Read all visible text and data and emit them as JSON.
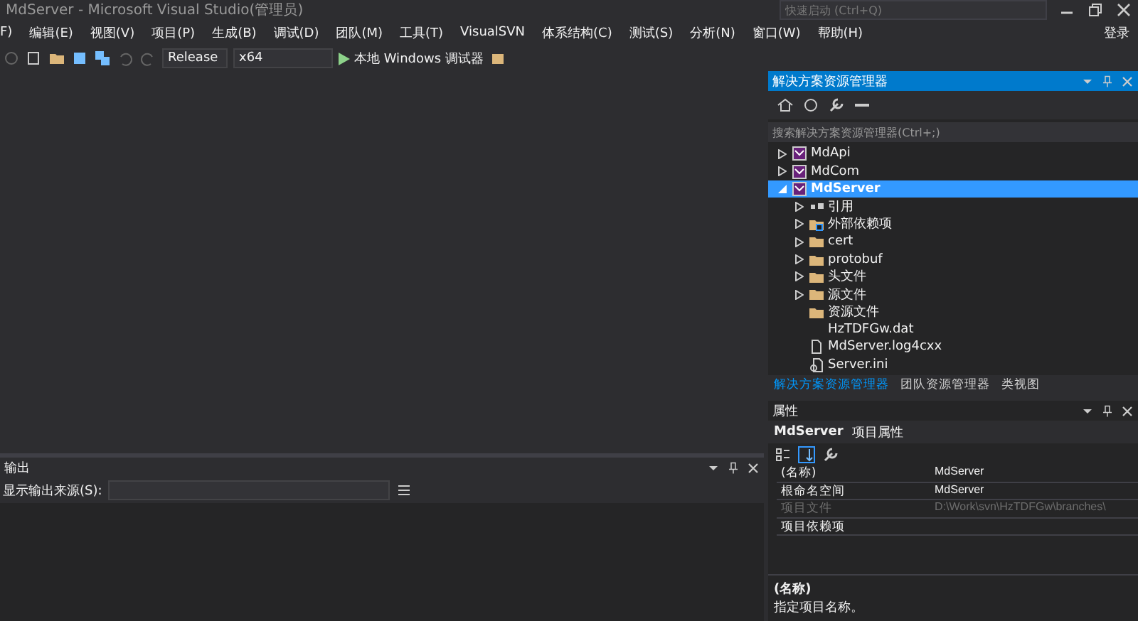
{
  "window": {
    "title": "MdServer - Microsoft Visual Studio(管理员)",
    "quick_launch": {
      "placeholder": "快速启动 (Ctrl+Q)"
    },
    "sign_in": "登录"
  },
  "menu": [
    "F)",
    "编辑(E)",
    "视图(V)",
    "项目(P)",
    "生成(B)",
    "调试(D)",
    "团队(M)",
    "工具(T)",
    "VisualSVN",
    "体系结构(C)",
    "测试(S)",
    "分析(N)",
    "窗口(W)",
    "帮助(H)"
  ],
  "toolbar": {
    "configuration": "Release",
    "platform": "x64",
    "start": "本地 Windows 调试器"
  },
  "solution_explorer": {
    "title": "解决方案资源管理器",
    "search": {
      "placeholder": "搜索解决方案资源管理器(Ctrl+;)"
    },
    "tree": [
      {
        "label": "MdApi",
        "kind": "project",
        "expandable": true,
        "expanded": false,
        "selected": false
      },
      {
        "label": "MdCom",
        "kind": "project",
        "expandable": true,
        "expanded": false,
        "selected": false
      },
      {
        "label": "MdServer",
        "kind": "project",
        "expandable": true,
        "expanded": true,
        "selected": true,
        "children": [
          {
            "label": "引用",
            "kind": "references",
            "expandable": true,
            "expanded": false,
            "selected": false
          },
          {
            "label": "外部依赖项",
            "kind": "deps",
            "expandable": true,
            "expanded": false,
            "selected": false
          },
          {
            "label": "cert",
            "kind": "folder",
            "expandable": true,
            "expanded": false,
            "selected": false
          },
          {
            "label": "protobuf",
            "kind": "folder",
            "expandable": true,
            "expanded": false,
            "selected": false
          },
          {
            "label": "头文件",
            "kind": "folder",
            "expandable": true,
            "expanded": false,
            "selected": false
          },
          {
            "label": "源文件",
            "kind": "folder",
            "expandable": true,
            "expanded": false,
            "selected": false
          },
          {
            "label": "资源文件",
            "kind": "folder",
            "expandable": false,
            "selected": false
          },
          {
            "label": "HzTDFGw.dat",
            "kind": "plain",
            "expandable": false,
            "selected": false
          },
          {
            "label": "MdServer.log4cxx",
            "kind": "file",
            "expandable": false,
            "selected": false
          },
          {
            "label": "Server.ini",
            "kind": "config",
            "expandable": false,
            "selected": false
          }
        ]
      }
    ],
    "tabs": [
      {
        "label": "解决方案资源管理器",
        "selected": true
      },
      {
        "label": "团队资源管理器",
        "selected": false
      },
      {
        "label": "类视图",
        "selected": false
      }
    ]
  },
  "properties": {
    "title": "属性",
    "object": "MdServer",
    "object_type": "项目属性",
    "rows": [
      {
        "name": "(名称)",
        "value": "MdServer",
        "disabled": false
      },
      {
        "name": "根命名空间",
        "value": "MdServer",
        "disabled": false
      },
      {
        "name": "项目文件",
        "value": "D:\\Work\\svn\\HzTDFGw\\branches\\",
        "disabled": true
      },
      {
        "name": "项目依赖项",
        "value": "",
        "disabled": false
      }
    ],
    "description_title": "(名称)",
    "description": "指定项目名称。"
  },
  "output": {
    "title": "输出",
    "source_label": "显示输出来源(S):"
  }
}
